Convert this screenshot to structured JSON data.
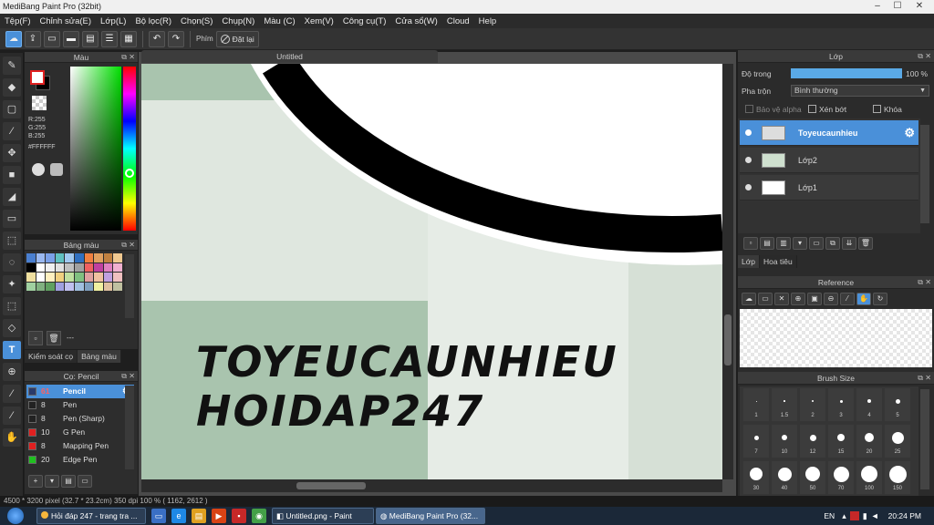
{
  "window": {
    "title": "MediBang Paint Pro (32bit)"
  },
  "menu": [
    "Tệp(F)",
    "Chỉnh sửa(E)",
    "Lớp(L)",
    "Bộ lọc(R)",
    "Chọn(S)",
    "Chụp(N)",
    "Màu (C)",
    "Xem(V)",
    "Công cụ(T)",
    "Cửa sổ(W)",
    "Cloud",
    "Help"
  ],
  "toolbar": {
    "phim_label": "Phím",
    "reset_label": "Đặt lại"
  },
  "color_panel": {
    "title": "Màu",
    "r": "R:255",
    "g": "G:255",
    "b": "B:255",
    "hex": "#FFFFFF"
  },
  "palette_panel": {
    "title": "Bảng màu",
    "footer_text": "---",
    "tabs": [
      "Kiểm soát cọ",
      "Bảng màu"
    ]
  },
  "brush_panel": {
    "title": "Cọ: Pencil",
    "items": [
      {
        "size": "61",
        "name": "Pencil",
        "color": "#2a3a6a"
      },
      {
        "size": "8",
        "name": "Pen",
        "color": "#222222"
      },
      {
        "size": "8",
        "name": "Pen (Sharp)",
        "color": "#222222"
      },
      {
        "size": "10",
        "name": "G Pen",
        "color": "#e02020"
      },
      {
        "size": "8",
        "name": "Mapping Pen",
        "color": "#e02020"
      },
      {
        "size": "20",
        "name": "Edge Pen",
        "color": "#20c020"
      }
    ]
  },
  "document": {
    "tab": "Untitled",
    "text_line1": "TOYEUCAUNHIEU",
    "text_line2": "HOIDAP247"
  },
  "layer_panel": {
    "title": "Lớp",
    "opacity_label": "Độ trong",
    "opacity_value": "100 %",
    "opacity_fraction": 1.0,
    "blend_label": "Pha trộn",
    "blend_value": "Bình thường",
    "protect_alpha": "Bảo vệ alpha",
    "clipping": "Xén bớt",
    "lock": "Khóa",
    "layers": [
      "Toyeucaunhieu",
      "Lớp2",
      "Lớp1"
    ],
    "tabs": [
      "Lớp",
      "Hoa tiêu"
    ]
  },
  "reference_panel": {
    "title": "Reference"
  },
  "brush_size_panel": {
    "title": "Brush Size",
    "row1": [
      "1",
      "1.5",
      "2",
      "3",
      "4",
      "5"
    ],
    "row2": [
      "7",
      "10",
      "12",
      "15",
      "20",
      "25"
    ],
    "row3": [
      "30",
      "40",
      "50",
      "70",
      "100",
      "150"
    ]
  },
  "status": {
    "text": "4500 * 3200 pixel  (32.7 * 23.2cm)  350 dpi  100 %  ( 1162, 2612 )"
  },
  "taskbar": {
    "tasks": [
      "Hỏi đáp 247 - trang tra ...",
      "Untitled.png - Paint",
      "MediBang Paint Pro (32..."
    ],
    "lang": "EN",
    "time": "20:24 PM"
  }
}
